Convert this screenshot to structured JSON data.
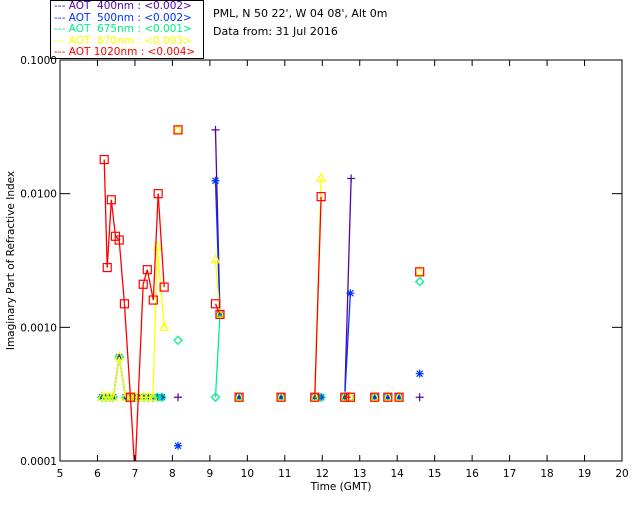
{
  "header": {
    "site": "PML, N 50 22', W 04 08', Alt 0m",
    "date": "Data from: 31 Jul 2016"
  },
  "chart_data": {
    "type": "scatter",
    "xlabel": "Time (GMT)",
    "ylabel": "Imaginary Part of Refractive Index",
    "xlim": [
      5,
      20
    ],
    "ylim": [
      0.0001,
      0.1
    ],
    "yscale": "log",
    "xticks": [
      "5",
      "6",
      "7",
      "8",
      "9",
      "10",
      "11",
      "12",
      "13",
      "14",
      "15",
      "16",
      "17",
      "18",
      "19",
      "20"
    ],
    "yticks": [
      "0.1000",
      "0.0100",
      "0.0010",
      "0.0001"
    ],
    "legend_placement": "top-left outside",
    "series": [
      {
        "name": "AOT  400nm : <0.002>",
        "color": "#5500aa",
        "marker": "plus",
        "points": [
          [
            6.12,
            0.0003
          ],
          [
            6.22,
            0.0003
          ],
          [
            6.32,
            0.0003
          ],
          [
            6.42,
            0.0003
          ],
          [
            6.58,
            0.0006
          ],
          [
            6.75,
            0.0003
          ],
          [
            6.88,
            0.0003
          ],
          [
            7.0,
            0.0003
          ],
          [
            7.12,
            0.0003
          ],
          [
            7.24,
            0.0003
          ],
          [
            7.36,
            0.0003
          ],
          [
            7.48,
            0.0003
          ],
          [
            7.6,
            0.0003
          ],
          [
            7.72,
            0.0003
          ],
          [
            8.15,
            0.0003
          ],
          [
            9.15,
            0.03
          ],
          [
            9.27,
            0.00125
          ],
          [
            9.78,
            0.0003
          ],
          [
            10.9,
            0.0003
          ],
          [
            11.8,
            0.0003
          ],
          [
            11.97,
            0.0003
          ],
          [
            12.6,
            0.0003
          ],
          [
            12.77,
            0.013
          ],
          [
            13.4,
            0.0003
          ],
          [
            13.75,
            0.0003
          ],
          [
            14.05,
            0.0003
          ],
          [
            14.6,
            0.0003
          ]
        ]
      },
      {
        "name": "AOT  500nm : <0.002>",
        "color": "#0033ff",
        "marker": "asterisk",
        "points": [
          [
            6.12,
            0.0003
          ],
          [
            6.22,
            0.0003
          ],
          [
            6.32,
            0.0003
          ],
          [
            6.42,
            0.0003
          ],
          [
            6.58,
            0.0006
          ],
          [
            6.75,
            0.0003
          ],
          [
            6.88,
            0.0003
          ],
          [
            7.0,
            0.0003
          ],
          [
            7.12,
            0.0003
          ],
          [
            7.24,
            0.0003
          ],
          [
            7.36,
            0.0003
          ],
          [
            7.48,
            0.0003
          ],
          [
            7.6,
            0.0003
          ],
          [
            7.72,
            0.0003
          ],
          [
            8.15,
            0.00013
          ],
          [
            9.15,
            0.0125
          ],
          [
            9.27,
            0.00125
          ],
          [
            9.78,
            0.0003
          ],
          [
            10.9,
            0.0003
          ],
          [
            11.8,
            0.0003
          ],
          [
            11.97,
            0.0003
          ],
          [
            12.6,
            0.0003
          ],
          [
            12.75,
            0.0018
          ],
          [
            13.4,
            0.0003
          ],
          [
            13.75,
            0.0003
          ],
          [
            14.05,
            0.0003
          ],
          [
            14.6,
            0.00045
          ]
        ]
      },
      {
        "name": "AOT  675nm : <0.001>",
        "color": "#00ee88",
        "marker": "diamond",
        "points": [
          [
            6.12,
            0.0003
          ],
          [
            6.22,
            0.0003
          ],
          [
            6.32,
            0.0003
          ],
          [
            6.42,
            0.0003
          ],
          [
            6.58,
            0.0006
          ],
          [
            6.75,
            0.0003
          ],
          [
            6.88,
            0.0003
          ],
          [
            7.0,
            0.0003
          ],
          [
            7.12,
            0.0003
          ],
          [
            7.24,
            0.0003
          ],
          [
            7.36,
            0.0003
          ],
          [
            7.48,
            0.0003
          ],
          [
            7.6,
            0.0003
          ],
          [
            7.72,
            0.0003
          ],
          [
            8.15,
            0.0008
          ],
          [
            9.15,
            0.0003
          ],
          [
            9.27,
            0.00125
          ],
          [
            9.78,
            0.0003
          ],
          [
            10.9,
            0.0003
          ],
          [
            11.8,
            0.0003
          ],
          [
            11.97,
            0.0003
          ],
          [
            12.6,
            0.0003
          ],
          [
            12.75,
            0.0003
          ],
          [
            13.4,
            0.0003
          ],
          [
            13.75,
            0.0003
          ],
          [
            14.05,
            0.0003
          ],
          [
            14.6,
            0.0022
          ]
        ]
      },
      {
        "name": "AOT  870nm : <0.003>",
        "color": "#ffff00",
        "marker": "triangle",
        "points": [
          [
            6.12,
            0.0003
          ],
          [
            6.22,
            0.0003
          ],
          [
            6.32,
            0.0003
          ],
          [
            6.42,
            0.0003
          ],
          [
            6.58,
            0.0006
          ],
          [
            6.75,
            0.0003
          ],
          [
            6.88,
            0.0003
          ],
          [
            7.0,
            0.0003
          ],
          [
            7.12,
            0.0003
          ],
          [
            7.24,
            0.0003
          ],
          [
            7.36,
            0.0003
          ],
          [
            7.48,
            0.0003
          ],
          [
            7.6,
            0.004
          ],
          [
            7.78,
            0.001
          ],
          [
            8.15,
            0.03
          ],
          [
            9.15,
            0.0032
          ],
          [
            9.27,
            0.00125
          ],
          [
            9.78,
            0.0003
          ],
          [
            10.9,
            0.0003
          ],
          [
            11.8,
            0.0003
          ],
          [
            11.97,
            0.013
          ],
          [
            12.6,
            0.0003
          ],
          [
            12.75,
            0.0003
          ],
          [
            13.4,
            0.0003
          ],
          [
            13.75,
            0.0003
          ],
          [
            14.05,
            0.0003
          ],
          [
            14.6,
            0.0026
          ]
        ]
      },
      {
        "name": "AOT 1020nm : <0.004>",
        "color": "#ff0000",
        "marker": "square",
        "points": [
          [
            6.18,
            0.018
          ],
          [
            6.26,
            0.0028
          ],
          [
            6.37,
            0.009
          ],
          [
            6.48,
            0.0048
          ],
          [
            6.58,
            0.0045
          ],
          [
            6.72,
            0.0015
          ],
          [
            6.88,
            0.0003
          ],
          [
            7.0,
            8e-05
          ],
          [
            7.22,
            0.0021
          ],
          [
            7.33,
            0.0027
          ],
          [
            7.49,
            0.0016
          ],
          [
            7.62,
            0.01
          ],
          [
            7.78,
            0.002
          ],
          [
            8.15,
            0.03
          ],
          [
            9.15,
            0.0015
          ],
          [
            9.27,
            0.00125
          ],
          [
            9.78,
            0.0003
          ],
          [
            10.9,
            0.0003
          ],
          [
            11.8,
            0.0003
          ],
          [
            11.97,
            0.0095
          ],
          [
            12.6,
            0.0003
          ],
          [
            12.75,
            0.0003
          ],
          [
            13.4,
            0.0003
          ],
          [
            13.75,
            0.0003
          ],
          [
            14.05,
            0.0003
          ],
          [
            14.6,
            0.0026
          ]
        ]
      }
    ]
  }
}
